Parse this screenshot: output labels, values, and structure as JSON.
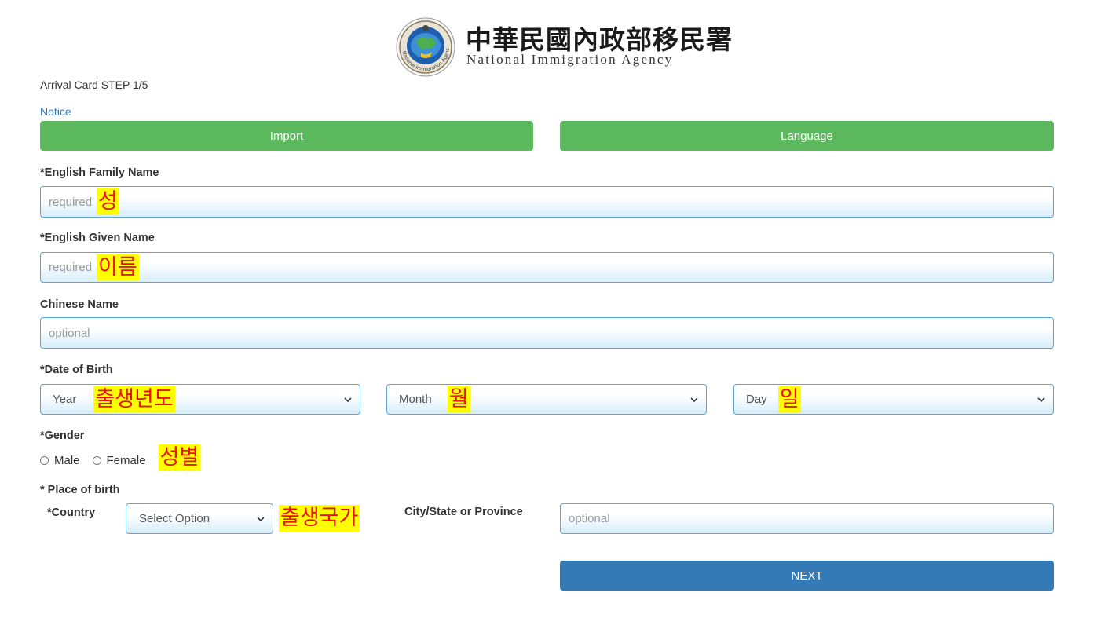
{
  "header": {
    "agency_name_zh": "中華民國內政部移民署",
    "agency_name_en": "National Immigration Agency",
    "seal_text": "National Immigration Agency"
  },
  "page": {
    "step": "Arrival Card STEP 1/5",
    "notice_link": "Notice"
  },
  "buttons": {
    "import": "Import",
    "language": "Language",
    "next": "NEXT"
  },
  "fields": {
    "family_name": {
      "label": "*English Family Name",
      "placeholder": "required",
      "annotation": "성"
    },
    "given_name": {
      "label": "*English Given Name",
      "placeholder": "required",
      "annotation": "이름"
    },
    "chinese_name": {
      "label": "Chinese Name",
      "placeholder": "optional"
    },
    "dob": {
      "label": "*Date of Birth",
      "year": {
        "value": "Year",
        "annotation": "출생년도"
      },
      "month": {
        "value": "Month",
        "annotation": "월"
      },
      "day": {
        "value": "Day",
        "annotation": "일"
      }
    },
    "gender": {
      "label": "*Gender",
      "options": [
        "Male",
        "Female"
      ],
      "annotation": "성별"
    },
    "place_of_birth": {
      "label": "* Place of birth",
      "country_label": "*Country",
      "country_value": "Select Option",
      "country_annotation": "출생국가",
      "city_label": "City/State or Province",
      "city_placeholder": "optional"
    }
  },
  "colors": {
    "green_button": "#5cb85c",
    "blue_button": "#337ab7",
    "link": "#337ab7",
    "field_border": "#5aa7d6",
    "annotation_bg": "#ffff00",
    "annotation_text": "#e81010"
  },
  "icons": {
    "seal": "national-immigration-agency-seal",
    "select_arrow": "chevron-down-icon",
    "radio": "radio-unchecked-icon"
  }
}
